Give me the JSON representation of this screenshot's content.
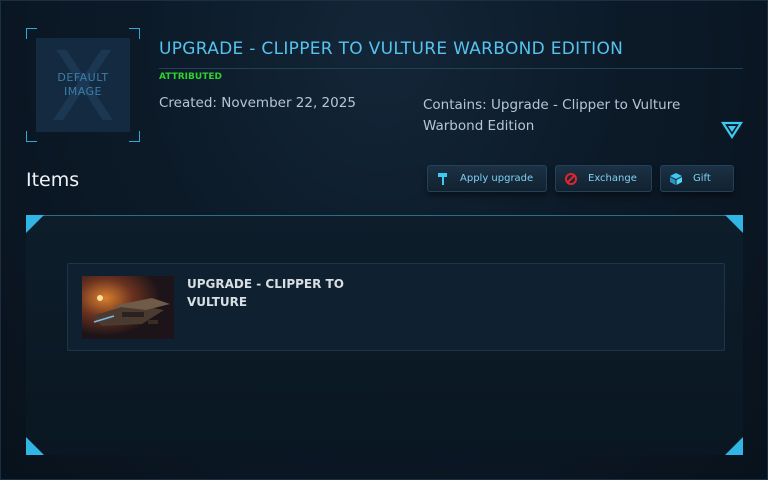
{
  "thumbnail": {
    "line1": "DEFAULT",
    "line2": "IMAGE",
    "watermark": "X"
  },
  "title": "UPGRADE - CLIPPER TO VULTURE WARBOND EDITION",
  "status": "ATTRIBUTED",
  "created": "Created: November 22, 2025",
  "contains": "Contains: Upgrade - Clipper to Vulture Warbond Edition",
  "items_heading": "Items",
  "buttons": {
    "apply": "Apply upgrade",
    "exchange": "Exchange",
    "gift": "Gift"
  },
  "item": {
    "name": "UPGRADE - CLIPPER TO VULTURE"
  },
  "icons": {
    "apply": "hammer-icon",
    "exchange": "circle-slash-icon",
    "gift": "gift-box-icon",
    "expand": "chevron-down-triangle-icon"
  },
  "colors": {
    "accent": "#55c3ee",
    "status": "#2fd12f",
    "exchange_icon": "#e0262c"
  }
}
